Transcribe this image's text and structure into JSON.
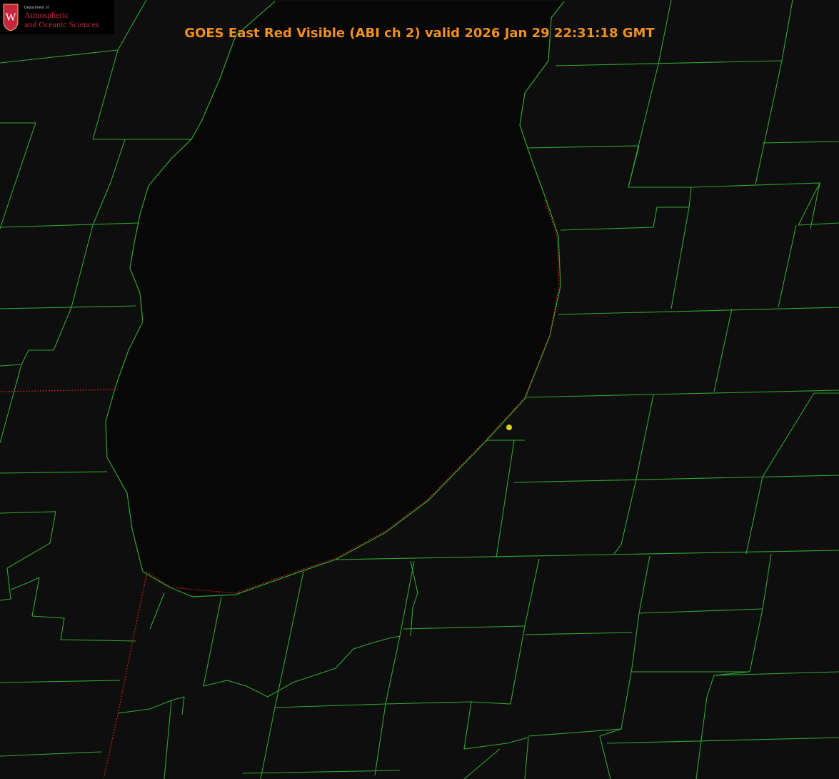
{
  "title": "GOES East Red Visible (ABI ch 2) valid 2026 Jan 29 22:31:18 GMT",
  "logo": {
    "dept": "Department of",
    "line1": "Atmospheric",
    "line2": "and Oceanic Sciences",
    "crest_letter": "W"
  },
  "colors": {
    "background": "#0e0e0e",
    "lake": "#070707",
    "county_lines": "#2fa52f",
    "state_border": "#c71f1f",
    "title": "#f0901f",
    "marker": "#d7d21a"
  },
  "map": {
    "imagery": "satellite red visible",
    "features": [
      "lake",
      "county boundaries",
      "state borders",
      "point marker"
    ]
  }
}
